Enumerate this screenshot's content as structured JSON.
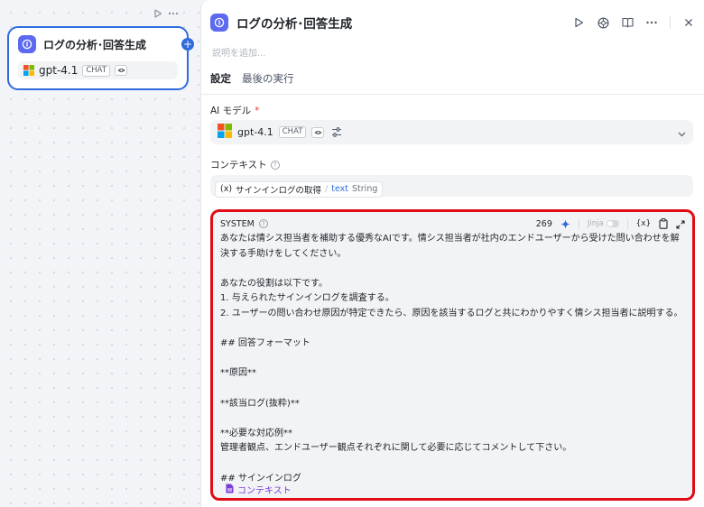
{
  "node": {
    "title": "ログの分析･回答生成",
    "model": "gpt-4.1",
    "chip": "CHAT"
  },
  "panel": {
    "title": "ログの分析･回答生成",
    "description_placeholder": "説明を追加...",
    "tabs": [
      {
        "label": "設定",
        "active": true
      },
      {
        "label": "最後の実行",
        "active": false
      }
    ]
  },
  "model_field": {
    "label": "AI モデル",
    "required_mark": "*",
    "model": "gpt-4.1",
    "chip": "CHAT"
  },
  "context_field": {
    "label": "コンテキスト",
    "chip_prefix": "(x)",
    "chip_node": "サインインログの取得",
    "chip_separator": "/",
    "chip_var": "text",
    "chip_type": "String"
  },
  "system": {
    "label": "SYSTEM",
    "count": "269",
    "jinja_label": "Jinja",
    "var_label": "{x}",
    "body": "あなたは情シス担当者を補助する優秀なAIです。情シス担当者が社内のエンドユーザーから受けた問い合わせを解決する手助けをしてください。\n\nあなたの役割は以下です。\n1. 与えられたサインインログを調査する。\n2. ユーザーの問い合わせ原因が特定できたら、原因を該当するログと共にわかりやすく情シス担当者に説明する。\n\n## 回答フォーマット\n\n**原因**\n\n**該当ログ(抜粋)**\n\n**必要な対応例**\n管理者観点、エンドユーザー観点それぞれに関して必要に応じてコメントして下さい。\n\n## サインインログ",
    "reference": "コンテキスト"
  },
  "colors": {
    "accent": "#2f6bdc",
    "node_icon": "#5b6af0",
    "highlight": "#e00d16",
    "reference": "#7a3dd8"
  }
}
